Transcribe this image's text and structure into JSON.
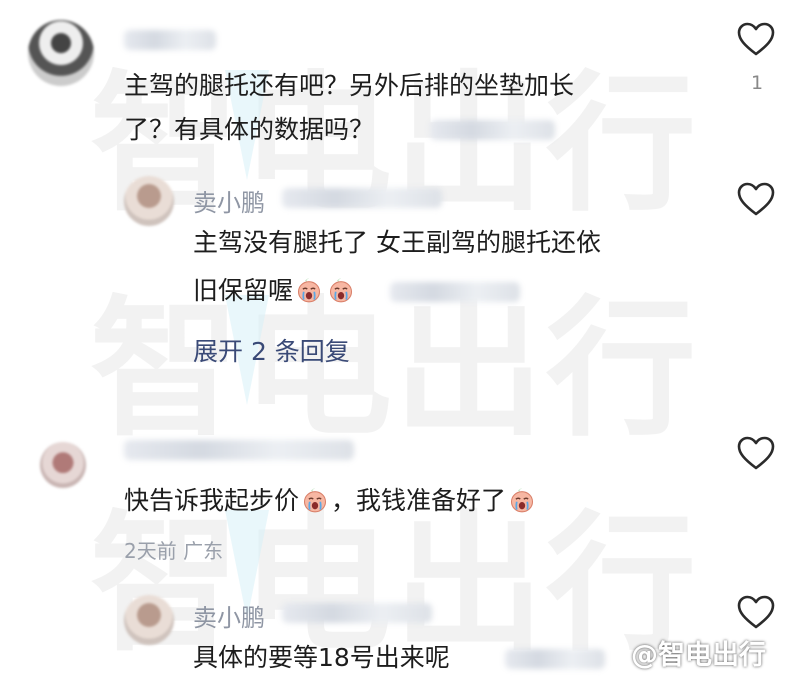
{
  "watermark": {
    "text": "智电出行",
    "label": "@智电出行"
  },
  "colors": {
    "text": "#1d1d1d",
    "username": "#8f96a4",
    "meta": "#9aa0ab",
    "link": "#3a4a77",
    "heart": "#2b2b2b"
  },
  "comments": [
    {
      "avatar_icon": "avatar-icon",
      "line1": "主驾的腿托还有吧？另外后排的坐垫加长",
      "line2": "了？有具体的数据吗？",
      "likes": "1",
      "heart_icon": "heart-outline-icon"
    },
    {
      "username": "卖小鹏",
      "line1": "主驾没有腿托了 女王副驾的腿托还依",
      "line2": "旧保留喔",
      "emoji": [
        "crying-face-emoji",
        "crying-face-emoji"
      ],
      "expand_replies": "展开 2 条回复",
      "heart_icon": "heart-outline-icon"
    },
    {
      "text_before": "快告诉我起步价",
      "text_after": "，我钱准备好了",
      "meta": "2天前 广东",
      "emoji": [
        "crying-face-emoji",
        "crying-face-emoji"
      ],
      "heart_icon": "heart-outline-icon"
    },
    {
      "username": "卖小鹏",
      "line1": "具体的要等18号出来呢",
      "heart_icon": "heart-outline-icon"
    }
  ]
}
